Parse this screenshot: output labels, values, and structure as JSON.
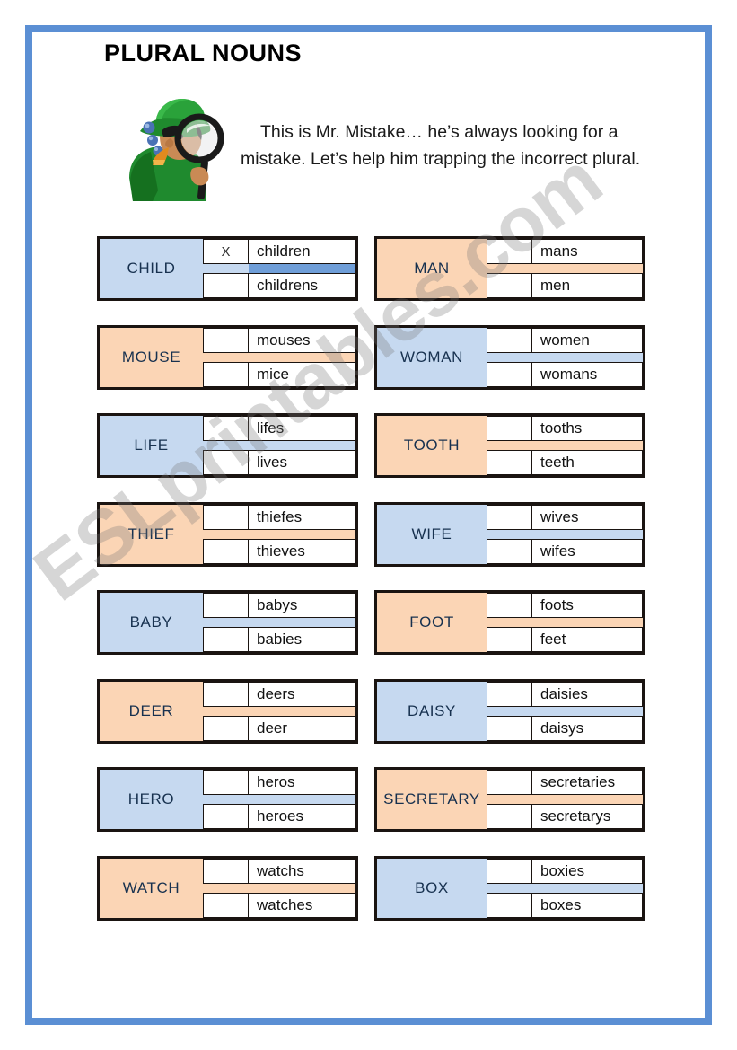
{
  "page": {
    "title": "PLURAL NOUNS",
    "intro": "This is Mr. Mistake… he’s always looking for a mistake. Let’s help him trapping the incorrect plural.",
    "watermark": "ESLprintables.com",
    "border_color": "#5b8fd4",
    "blue": "#c6d9f0",
    "peach": "#fbd5b5",
    "blue_highlight": "#6f9ed8",
    "blue_band": "#c6d9f0",
    "peach_band": "#fbd5b5"
  },
  "exercise": {
    "rows": [
      {
        "left": {
          "word": "CHILD",
          "color": "blue",
          "top": {
            "mark": "X",
            "plural": "children",
            "marked": true
          },
          "bottom": {
            "mark": "",
            "plural": "childrens",
            "marked": false
          }
        },
        "right": {
          "word": "MAN",
          "color": "peach",
          "top": {
            "mark": "",
            "plural": "mans",
            "marked": false
          },
          "bottom": {
            "mark": "",
            "plural": "men",
            "marked": false
          }
        }
      },
      {
        "left": {
          "word": "MOUSE",
          "color": "peach",
          "top": {
            "mark": "",
            "plural": "mouses",
            "marked": false
          },
          "bottom": {
            "mark": "",
            "plural": "mice",
            "marked": false
          }
        },
        "right": {
          "word": "WOMAN",
          "color": "blue",
          "top": {
            "mark": "",
            "plural": "women",
            "marked": false
          },
          "bottom": {
            "mark": "",
            "plural": "womans",
            "marked": false
          }
        }
      },
      {
        "left": {
          "word": "LIFE",
          "color": "blue",
          "top": {
            "mark": "",
            "plural": "lifes",
            "marked": false
          },
          "bottom": {
            "mark": "",
            "plural": "lives",
            "marked": false
          }
        },
        "right": {
          "word": "TOOTH",
          "color": "peach",
          "top": {
            "mark": "",
            "plural": "tooths",
            "marked": false
          },
          "bottom": {
            "mark": "",
            "plural": "teeth",
            "marked": false
          }
        }
      },
      {
        "left": {
          "word": "THIEF",
          "color": "peach",
          "top": {
            "mark": "",
            "plural": "thiefes",
            "marked": false
          },
          "bottom": {
            "mark": "",
            "plural": "thieves",
            "marked": false
          }
        },
        "right": {
          "word": "WIFE",
          "color": "blue",
          "top": {
            "mark": "",
            "plural": "wives",
            "marked": false
          },
          "bottom": {
            "mark": "",
            "plural": "wifes",
            "marked": false
          }
        }
      },
      {
        "left": {
          "word": "BABY",
          "color": "blue",
          "top": {
            "mark": "",
            "plural": "babys",
            "marked": false
          },
          "bottom": {
            "mark": "",
            "plural": "babies",
            "marked": false
          }
        },
        "right": {
          "word": "FOOT",
          "color": "peach",
          "top": {
            "mark": "",
            "plural": "foots",
            "marked": false
          },
          "bottom": {
            "mark": "",
            "plural": "feet",
            "marked": false
          }
        }
      },
      {
        "left": {
          "word": "DEER",
          "color": "peach",
          "top": {
            "mark": "",
            "plural": "deers",
            "marked": false
          },
          "bottom": {
            "mark": "",
            "plural": "deer",
            "marked": false
          }
        },
        "right": {
          "word": "DAISY",
          "color": "blue",
          "top": {
            "mark": "",
            "plural": "daisies",
            "marked": false
          },
          "bottom": {
            "mark": "",
            "plural": "daisys",
            "marked": false
          }
        }
      },
      {
        "left": {
          "word": "HERO",
          "color": "blue",
          "top": {
            "mark": "",
            "plural": "heros",
            "marked": false
          },
          "bottom": {
            "mark": "",
            "plural": "heroes",
            "marked": false
          }
        },
        "right": {
          "word": "SECRETARY",
          "color": "peach",
          "top": {
            "mark": "",
            "plural": "secretaries",
            "marked": false
          },
          "bottom": {
            "mark": "",
            "plural": "secretarys",
            "marked": false
          }
        }
      },
      {
        "left": {
          "word": "WATCH",
          "color": "peach",
          "top": {
            "mark": "",
            "plural": "watchs",
            "marked": false
          },
          "bottom": {
            "mark": "",
            "plural": "watches",
            "marked": false
          }
        },
        "right": {
          "word": "BOX",
          "color": "blue",
          "top": {
            "mark": "",
            "plural": "boxies",
            "marked": false
          },
          "bottom": {
            "mark": "",
            "plural": "boxes",
            "marked": false
          }
        }
      }
    ]
  }
}
